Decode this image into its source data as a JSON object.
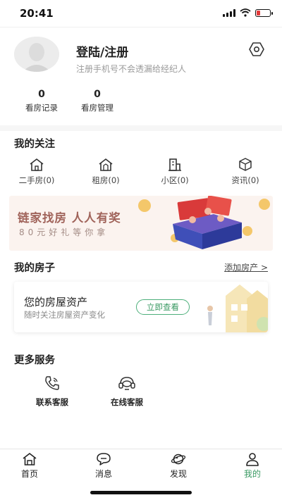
{
  "status_bar": {
    "time": "20:41"
  },
  "profile": {
    "title": "登陆/注册",
    "subtitle": "注册手机号不会透漏给经纪人",
    "stats": [
      {
        "value": "0",
        "label": "看房记录"
      },
      {
        "value": "0",
        "label": "看房管理"
      }
    ]
  },
  "follow": {
    "title": "我的关注",
    "items": [
      {
        "label": "二手房(0)",
        "icon": "house-icon"
      },
      {
        "label": "租房(0)",
        "icon": "rental-house-icon"
      },
      {
        "label": "小区(0)",
        "icon": "building-icon"
      },
      {
        "label": "资讯(0)",
        "icon": "cube-icon"
      }
    ]
  },
  "banner": {
    "title": "链家找房 人人有奖",
    "subtitle": "80元好礼等你拿"
  },
  "my_house": {
    "title": "我的房子",
    "link": "添加房产 >",
    "card_title": "您的房屋资产",
    "card_subtitle": "随时关注房屋资产变化",
    "button": "立即查看"
  },
  "services": {
    "title": "更多服务",
    "items": [
      {
        "label": "联系客服",
        "icon": "phone-icon"
      },
      {
        "label": "在线客服",
        "icon": "headset-icon"
      }
    ]
  },
  "tabbar": {
    "items": [
      {
        "label": "首页",
        "icon": "home-icon"
      },
      {
        "label": "消息",
        "icon": "message-icon"
      },
      {
        "label": "发现",
        "icon": "planet-icon"
      },
      {
        "label": "我的",
        "icon": "person-icon"
      }
    ],
    "active_color": "#3a9a63"
  }
}
